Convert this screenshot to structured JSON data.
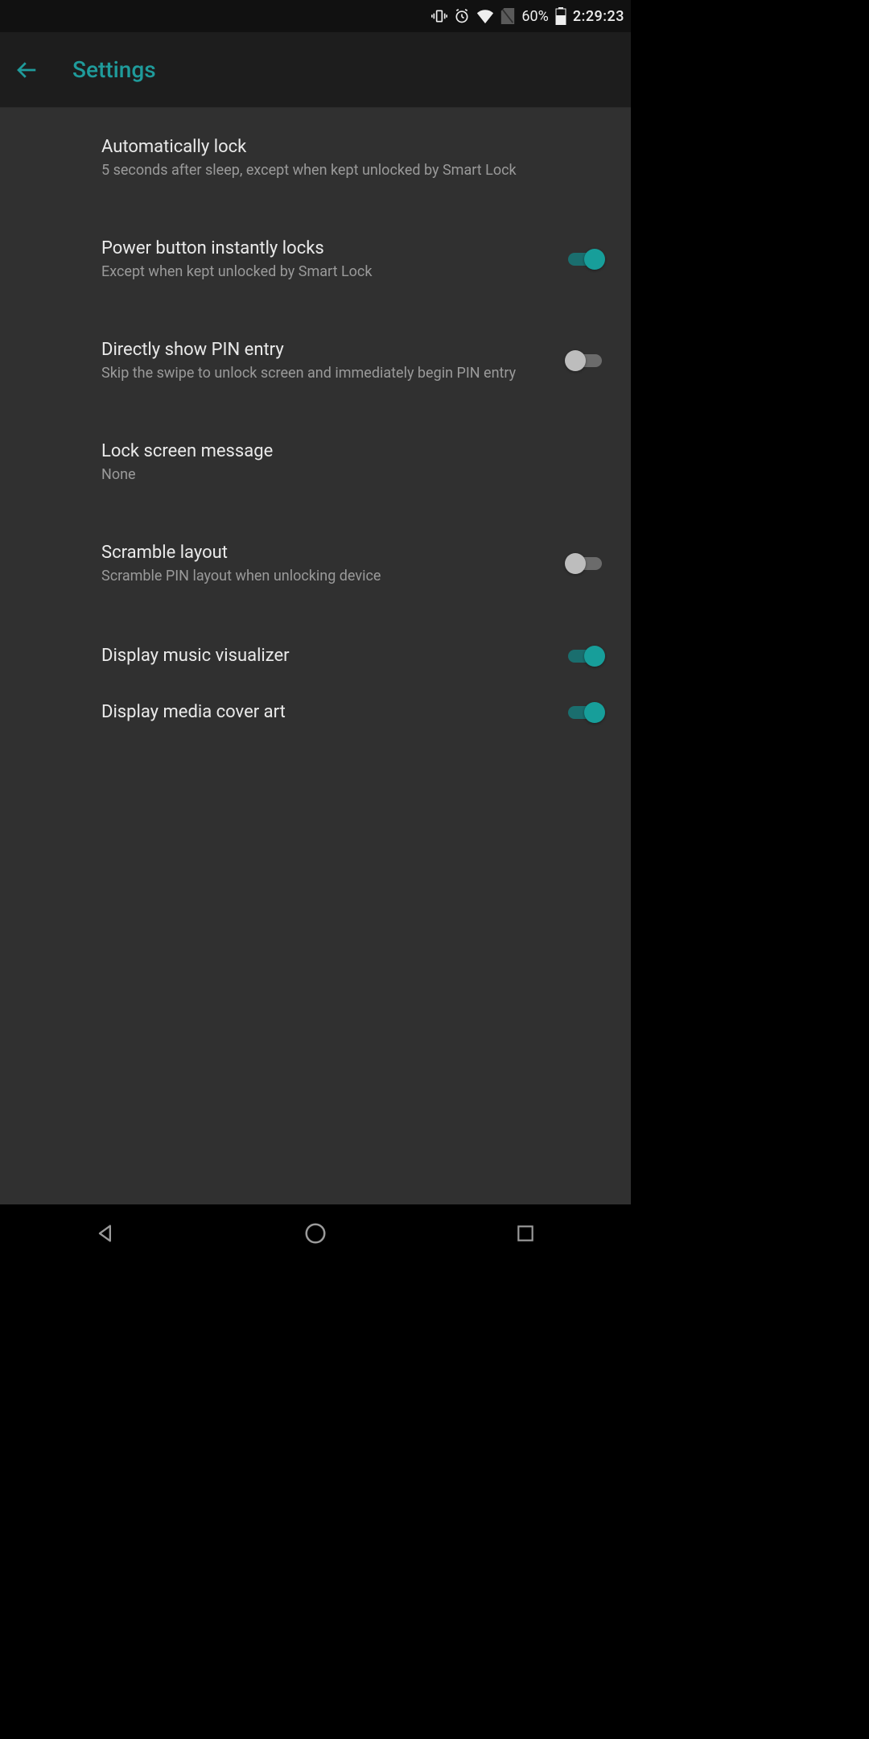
{
  "status": {
    "battery_pct": "60%",
    "time": "2:29:23"
  },
  "header": {
    "title": "Settings"
  },
  "colors": {
    "accent": "#179e9a",
    "bg": "#303030"
  },
  "items": [
    {
      "title": "Automatically lock",
      "subtitle": "5 seconds after sleep, except when kept unlocked by Smart Lock",
      "toggle": null
    },
    {
      "title": "Power button instantly locks",
      "subtitle": "Except when kept unlocked by Smart Lock",
      "toggle": true
    },
    {
      "title": "Directly show PIN entry",
      "subtitle": "Skip the swipe to unlock screen and immediately begin PIN entry",
      "toggle": false
    },
    {
      "title": "Lock screen message",
      "subtitle": "None",
      "toggle": null
    },
    {
      "title": "Scramble layout",
      "subtitle": "Scramble PIN layout when unlocking device",
      "toggle": false
    },
    {
      "title": "Display music visualizer",
      "subtitle": "",
      "toggle": true
    },
    {
      "title": "Display media cover art",
      "subtitle": "",
      "toggle": true
    }
  ]
}
